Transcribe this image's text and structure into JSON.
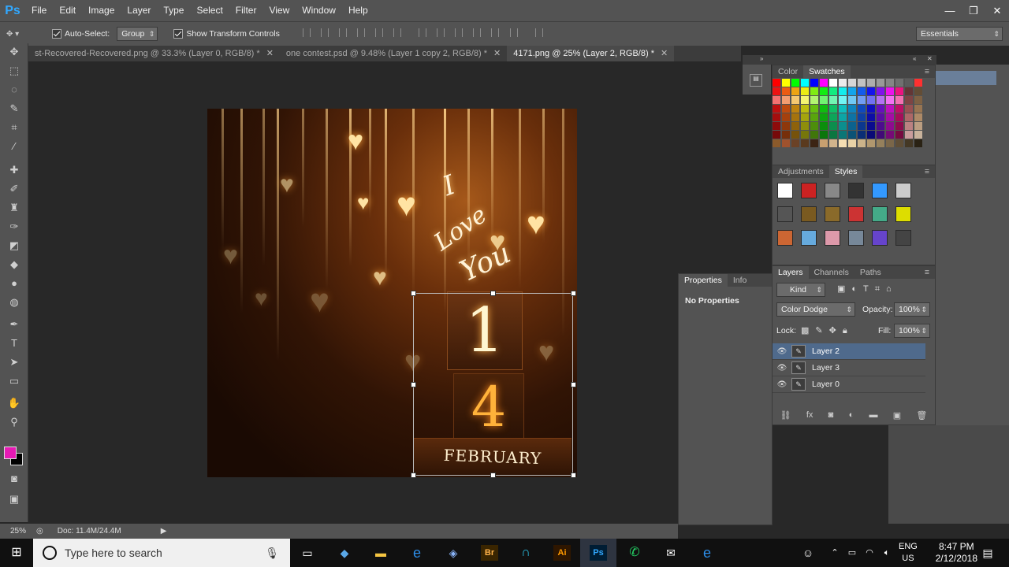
{
  "app": {
    "logo": "Ps"
  },
  "menubar": {
    "items": [
      "File",
      "Edit",
      "Image",
      "Layer",
      "Type",
      "Select",
      "Filter",
      "View",
      "Window",
      "Help"
    ]
  },
  "window_controls": {
    "minimize": "—",
    "restore": "❐",
    "close": "✕"
  },
  "options": {
    "auto_select_label": "Auto-Select:",
    "auto_select_value": "Group",
    "show_transform_label": "Show Transform Controls",
    "workspace": "Essentials"
  },
  "tabs": [
    {
      "label": "st-Recovered-Recovered.png @ 33.3% (Layer 0, RGB/8) *"
    },
    {
      "label": "one contest.psd @ 9.48% (Layer 1 copy 2, RGB/8) *"
    },
    {
      "label": "4171.png @ 25% (Layer 2, RGB/8) *"
    }
  ],
  "artwork": {
    "script_text_line1": "I",
    "script_text_line2": "Love",
    "script_text_line3": "You",
    "digit1": "1",
    "digit2": "4",
    "month": "FEBRUARY"
  },
  "color_panel": {
    "tabs": [
      "Color",
      "Swatches"
    ],
    "active": "Swatches"
  },
  "styles_panel": {
    "tabs": [
      "Adjustments",
      "Styles"
    ],
    "active": "Styles"
  },
  "properties_panel": {
    "tabs": [
      "Properties",
      "Info"
    ],
    "message": "No Properties"
  },
  "layers_panel": {
    "tabs": [
      "Layers",
      "Channels",
      "Paths"
    ],
    "kind": "Kind",
    "blend_mode": "Color Dodge",
    "opacity_label": "Opacity:",
    "opacity": "100%",
    "lock_label": "Lock:",
    "fill_label": "Fill:",
    "fill": "100%",
    "layers": [
      {
        "name": "Layer 2",
        "selected": true
      },
      {
        "name": "Layer 3",
        "selected": false
      },
      {
        "name": "Layer 0",
        "selected": false
      }
    ]
  },
  "status": {
    "zoom": "25%",
    "doc": "Doc: 11.4M/24.4M"
  },
  "taskbar": {
    "search_placeholder": "Type here to search",
    "lang": "ENG",
    "region": "US",
    "time": "8:47 PM",
    "date": "2/12/2018",
    "app_labels": {
      "br": "Br",
      "ai": "Ai",
      "ps": "Ps"
    }
  },
  "colors": {
    "foreground": "#e61ab4",
    "background": "#000000",
    "selection": "#4f6a8c"
  }
}
